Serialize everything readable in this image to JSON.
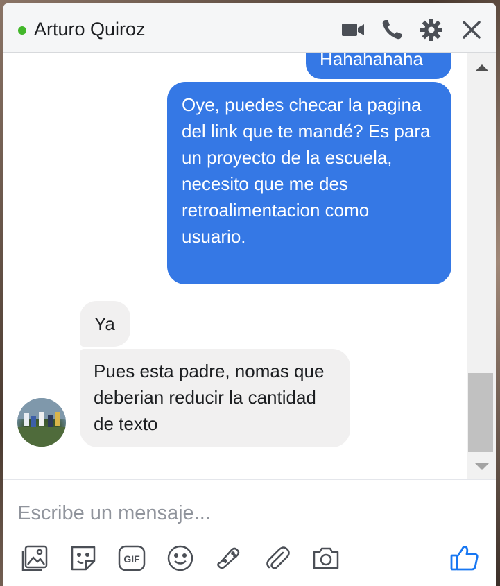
{
  "window": {
    "contact_name": "Arturo Quiroz",
    "status": "online",
    "status_color": "#42b72a"
  },
  "header_icons": [
    "video-call-icon",
    "phone-icon",
    "gear-icon",
    "close-icon"
  ],
  "messages": [
    {
      "direction": "out",
      "text": "Hahahahaha"
    },
    {
      "direction": "out",
      "text": "Oye, puedes checar la pagina del link que te mandé? Es para un proyecto de la escuela, necesito que me des retroalimentacion como usuario."
    },
    {
      "direction": "in",
      "text": "Ya"
    },
    {
      "direction": "in",
      "text": "Pues esta padre, nomas que deberian reducir la cantidad de texto"
    }
  ],
  "composer": {
    "placeholder": "Escribe un mensaje...",
    "tools": [
      "image-icon",
      "sticker-icon",
      "gif-icon",
      "emoji-icon",
      "game-icon",
      "attachment-icon",
      "camera-icon",
      "like-icon"
    ]
  },
  "colors": {
    "outgoing_bubble": "#3578e5",
    "incoming_bubble": "#f1f0f0",
    "accent": "#1877f2"
  }
}
